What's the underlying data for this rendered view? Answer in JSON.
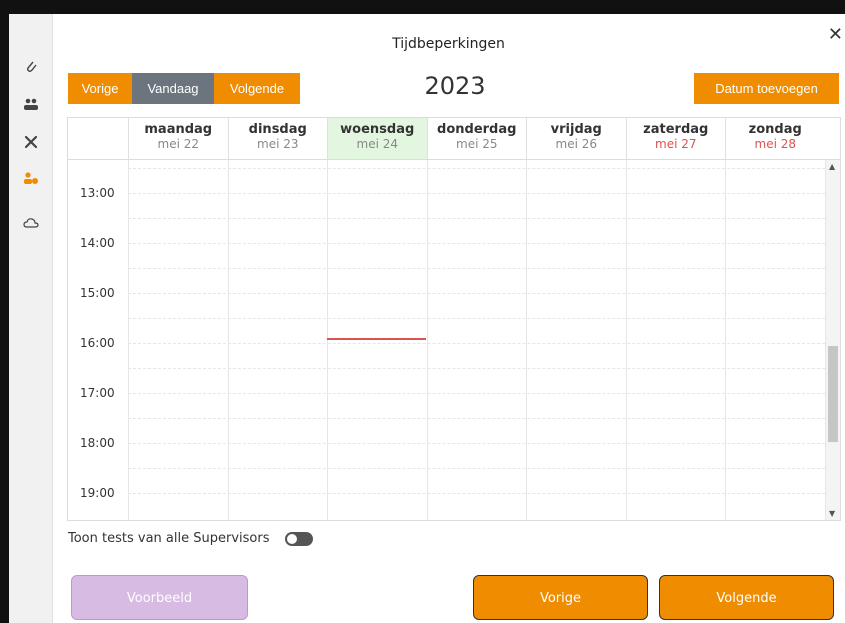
{
  "modal": {
    "title": "Tijdbeperkingen",
    "close_icon": "close-icon"
  },
  "sidebar": {
    "icons": [
      {
        "name": "paperclip-icon",
        "glyph": "✎",
        "active": false
      },
      {
        "name": "users-icon",
        "glyph": "👥",
        "active": false
      },
      {
        "name": "tools-icon",
        "glyph": "✕",
        "active": false
      },
      {
        "name": "user-clock-icon",
        "glyph": "👤",
        "active": true
      },
      {
        "name": "cloud-icon",
        "glyph": "☁",
        "active": false
      }
    ]
  },
  "toolbar": {
    "prev_label": "Vorige",
    "today_label": "Vandaag",
    "next_label": "Volgende",
    "year": "2023",
    "add_date_label": "Datum toevoegen"
  },
  "calendar": {
    "days": [
      {
        "name": "maandag",
        "date": "mei 22",
        "today": false,
        "weekend": false
      },
      {
        "name": "dinsdag",
        "date": "mei 23",
        "today": false,
        "weekend": false
      },
      {
        "name": "woensdag",
        "date": "mei 24",
        "today": true,
        "weekend": false
      },
      {
        "name": "donderdag",
        "date": "mei 25",
        "today": false,
        "weekend": false
      },
      {
        "name": "vrijdag",
        "date": "mei 26",
        "today": false,
        "weekend": false
      },
      {
        "name": "zaterdag",
        "date": "mei 27",
        "today": false,
        "weekend": true
      },
      {
        "name": "zondag",
        "date": "mei 28",
        "today": false,
        "weekend": true
      }
    ],
    "times": [
      "13:00",
      "14:00",
      "15:00",
      "16:00",
      "17:00",
      "18:00",
      "19:00"
    ]
  },
  "options": {
    "show_all_label": "Toon tests van alle Supervisors",
    "show_all_on": false
  },
  "footer": {
    "preview_label": "Voorbeeld",
    "prev_label": "Vorige",
    "next_label": "Volgende"
  },
  "colors": {
    "accent": "#f08c00",
    "today_bg": "#e3f7e0",
    "weekend": "#d9534f",
    "now_line": "#d9534f"
  }
}
